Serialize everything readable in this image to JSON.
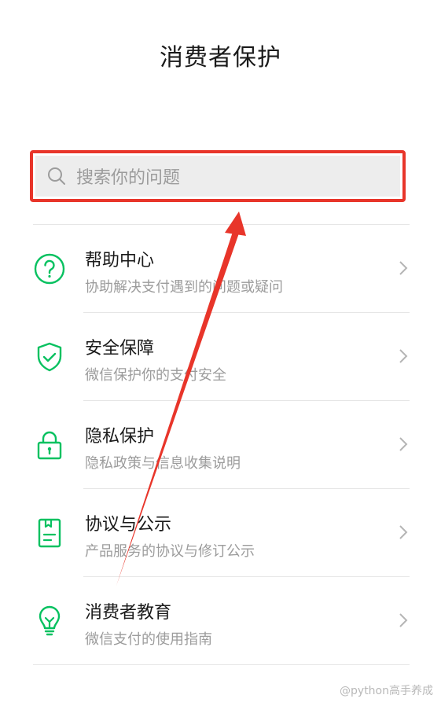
{
  "page": {
    "title": "消费者保护"
  },
  "search": {
    "placeholder": "搜索你的问题"
  },
  "items": [
    {
      "title": "帮助中心",
      "desc": "协助解决支付遇到的问题或疑问",
      "icon": "question-circle-icon"
    },
    {
      "title": "安全保障",
      "desc": "微信保护你的支付安全",
      "icon": "shield-check-icon"
    },
    {
      "title": "隐私保护",
      "desc": "隐私政策与信息收集说明",
      "icon": "lock-icon"
    },
    {
      "title": "协议与公示",
      "desc": "产品服务的协议与修订公示",
      "icon": "document-icon"
    },
    {
      "title": "消费者教育",
      "desc": "微信支付的使用指南",
      "icon": "lightbulb-icon"
    }
  ],
  "watermark": {
    "text": "@python高手养成"
  },
  "colors": {
    "accent": "#07c160",
    "highlight": "#e8352a",
    "muted": "#9c9c9c"
  }
}
